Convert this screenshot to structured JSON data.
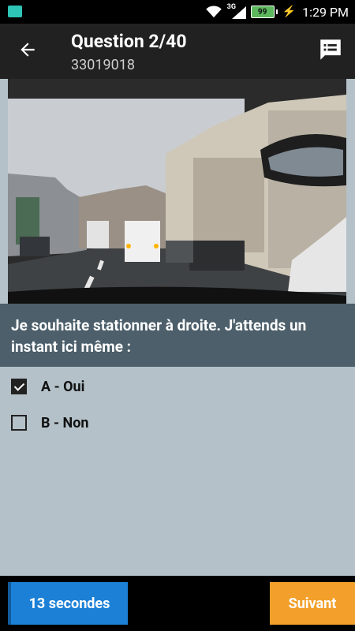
{
  "status_bar": {
    "network_type": "3G",
    "battery_level": "99",
    "time": "1:29 PM"
  },
  "app_bar": {
    "title": "Question 2/40",
    "subtitle": "33019018"
  },
  "question": {
    "text": "Je souhaite stationner à droite. J'attends un instant ici même :"
  },
  "answers": [
    {
      "label": "A - Oui",
      "checked": true
    },
    {
      "label": "B - Non",
      "checked": false
    }
  ],
  "footer": {
    "timer_label": "13 secondes",
    "next_label": "Suivant"
  },
  "colors": {
    "app_bar": "#212121",
    "question_bg": "#4c5f6a",
    "answers_bg": "#b4c1c8",
    "timer_button": "#1c80d6",
    "next_button": "#f2a02b"
  }
}
